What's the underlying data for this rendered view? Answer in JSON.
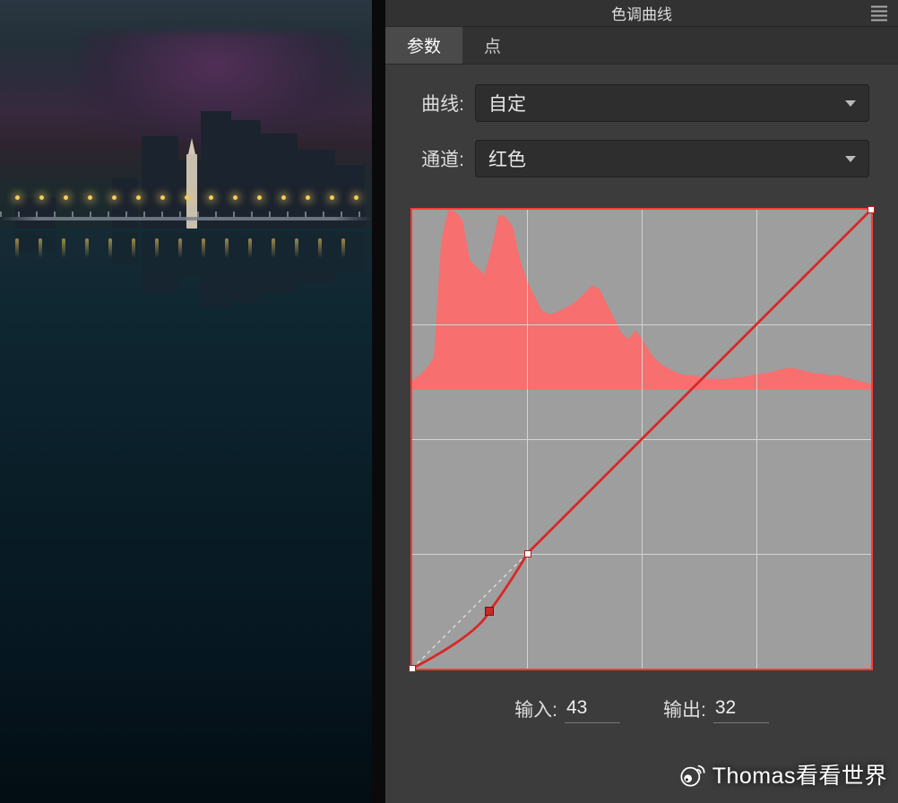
{
  "panel": {
    "title": "色调曲线",
    "tabs": {
      "parametric": "参数",
      "point": "点"
    },
    "curve_label": "曲线:",
    "curve_value": "自定",
    "channel_label": "通道:",
    "channel_value": "红色",
    "input_label": "输入:",
    "input_value": "43",
    "output_label": "输出:",
    "output_value": "32"
  },
  "watermark": "Thomas看看世界",
  "chart_data": {
    "type": "line",
    "title": "Tone Curve (Red Channel)",
    "xlabel": "输入",
    "ylabel": "输出",
    "xlim": [
      0,
      255
    ],
    "ylim": [
      0,
      255
    ],
    "series": [
      {
        "name": "identity",
        "x": [
          0,
          255
        ],
        "y": [
          0,
          255
        ]
      },
      {
        "name": "curve",
        "x": [
          0,
          43,
          64,
          255
        ],
        "y": [
          0,
          32,
          64,
          255
        ]
      }
    ],
    "active_point": {
      "x": 43,
      "y": 32
    },
    "histogram": {
      "channel": "red",
      "bins_x": [
        0,
        4,
        8,
        12,
        16,
        20,
        24,
        28,
        32,
        36,
        40,
        44,
        48,
        52,
        56,
        60,
        64,
        68,
        72,
        76,
        80,
        84,
        88,
        92,
        96,
        100,
        104,
        108,
        112,
        116,
        120,
        124,
        128,
        132,
        136,
        140,
        144,
        148,
        152,
        156,
        160,
        164,
        168,
        172,
        176,
        180,
        184,
        188,
        192,
        196,
        200,
        204,
        208,
        212,
        216,
        220,
        224,
        228,
        232,
        236,
        240,
        244,
        248,
        252,
        255
      ],
      "counts": [
        5,
        8,
        12,
        18,
        82,
        100,
        99,
        94,
        72,
        68,
        64,
        78,
        97,
        96,
        90,
        72,
        60,
        52,
        44,
        42,
        43,
        45,
        47,
        50,
        54,
        58,
        56,
        48,
        40,
        32,
        28,
        33,
        28,
        21,
        16,
        13,
        11,
        9,
        8,
        8,
        7,
        6,
        6,
        6,
        6,
        7,
        7,
        8,
        9,
        9,
        10,
        11,
        12,
        12,
        11,
        10,
        9,
        9,
        8,
        8,
        7,
        6,
        5,
        4,
        3
      ]
    }
  }
}
